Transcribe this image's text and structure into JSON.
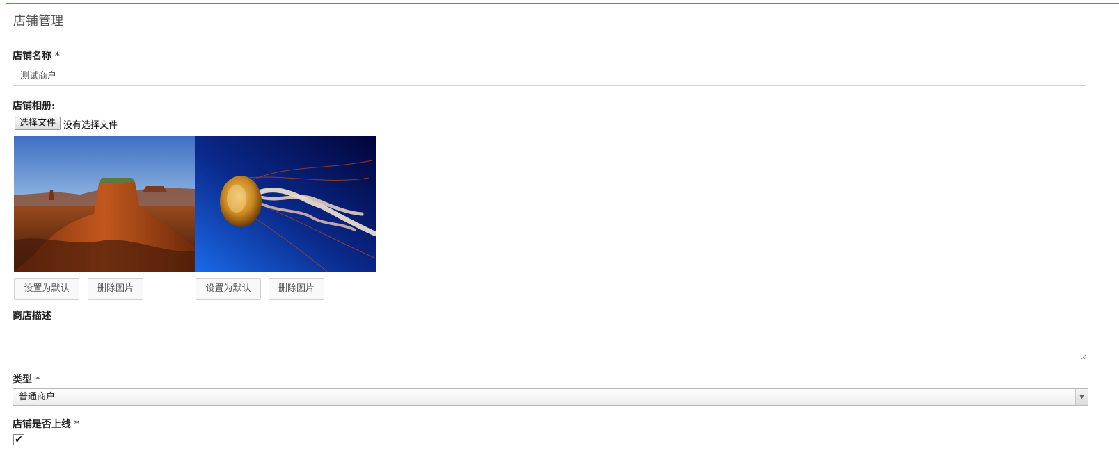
{
  "page": {
    "title": "店铺管理"
  },
  "store_name": {
    "label": "店铺名称",
    "required_mark": "*",
    "value": "测试商户"
  },
  "album": {
    "label": "店铺相册:",
    "choose_file_label": "选择文件",
    "file_status": "没有选择文件",
    "photos": [
      {
        "subject": "desert butte landscape",
        "set_default_label": "设置为默认",
        "delete_label": "删除图片"
      },
      {
        "subject": "jellyfish in blue water",
        "set_default_label": "设置为默认",
        "delete_label": "删除图片"
      }
    ]
  },
  "description": {
    "label": "商店描述",
    "value": ""
  },
  "type": {
    "label": "类型",
    "required_mark": "*",
    "selected": "普通商户"
  },
  "online": {
    "label": "店铺是否上线",
    "required_mark": "*",
    "checked": true
  },
  "colors": {
    "accent_border": "#3aa35c"
  },
  "icons": {
    "select_arrow": "triangle-down-icon",
    "checkbox": "checkmark-icon",
    "resize": "resize-grip-icon"
  }
}
